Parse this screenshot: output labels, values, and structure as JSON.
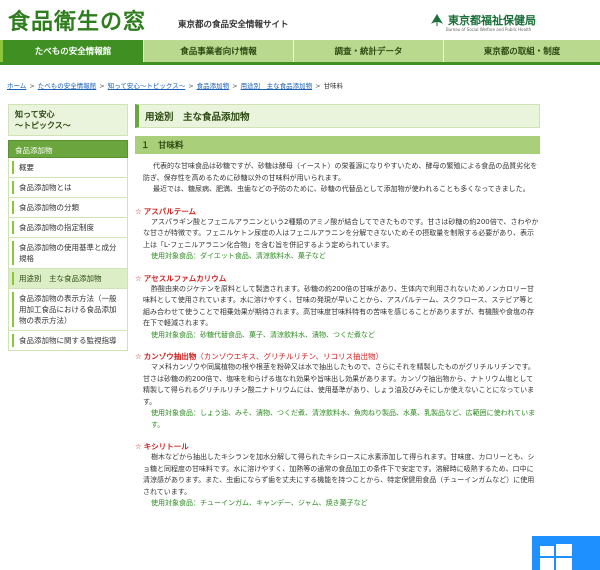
{
  "header": {
    "site_title": "食品衛生の窓",
    "site_subtitle": "東京都の食品安全情報サイト",
    "org_name": "東京都福祉保健局",
    "org_name_en": "Bureau of Social Welfare and Public Health"
  },
  "nav": {
    "items": [
      {
        "label": "たべもの安全情報館"
      },
      {
        "label": "食品事業者向け情報"
      },
      {
        "label": "調査・統計データ"
      },
      {
        "label": "東京都の取組・制度"
      }
    ]
  },
  "breadcrumb": {
    "items": [
      {
        "label": "ホーム"
      },
      {
        "label": "たべもの安全情報館"
      },
      {
        "label": "知って安心～トピックス～"
      },
      {
        "label": "食品添加物"
      },
      {
        "label": "用途別　主な食品添加物"
      }
    ],
    "current": "甘味料",
    "separator": ">"
  },
  "sidebar": {
    "heading_line1": "知って安心",
    "heading_line2": "～トピックス～",
    "category": "食品添加物",
    "items": [
      {
        "label": "概要"
      },
      {
        "label": "食品添加物とは"
      },
      {
        "label": "食品添加物の分類"
      },
      {
        "label": "食品添加物の指定制度"
      },
      {
        "label": "食品添加物の使用基準と成分規格"
      },
      {
        "label": "用途別　主な食品添加物"
      },
      {
        "label": "食品添加物の表示方法（一般用加工食品における食品添加物の表示方法）"
      },
      {
        "label": "食品添加物に関する監視指導"
      }
    ]
  },
  "main": {
    "page_title": "用途別　主な食品添加物",
    "section_title": "１　甘味料",
    "intro_1": "代表的な甘味食品は砂糖ですが、砂糖は酵母（イースト）の栄養源になりやすいため、酵母の繁殖による食品の品質劣化を防ぎ、保存性を高めるために砂糖以外の甘味料が用いられます。",
    "intro_2": "最近では、糖尿病、肥満、虫歯などの予防のために、砂糖の代替品として添加物が使われることも多くなってきました。",
    "items": [
      {
        "title": "アスパルテーム",
        "alias": "",
        "body": "アスパラギン酸とフェニルアラニンという2種類のアミノ酸が結合してできたものです。甘さは砂糖の約200倍で、さわやかな甘さが特徴です。フェニルケトン尿症の人はフェニルアラニンを分解できないためその摂取量を制限する必要があり、表示上は「L-フェニルアラニン化合物」を含む旨を併記するよう定められています。",
        "food": "使用対象食品：ダイエット食品、清涼飲料水、菓子など"
      },
      {
        "title": "アセスルファムカリウム",
        "alias": "",
        "body": "酢酸由来のジケテンを原料として製造されます。砂糖の約200倍の甘味があり、生体内で利用されないためノンカロリー甘味料として使用されています。水に溶けやすく、甘味の発現が早いことから、アスパルテーム、スクラロース、ステビア等と組み合わせて使うことで相乗効果が期待されます。高甘味度甘味料特有の苦味を感じることがありますが、有機酸や食塩の存在下で軽減されます。",
        "food": "使用対象食品：砂糖代替食品、菓子、清涼飲料水、漬物、つくだ煮など"
      },
      {
        "title": "カンゾウ抽出物",
        "alias": "（カンゾウエキス、グリチルリチン、リコリス抽出物）",
        "body": "マメ科カンゾウや同属植物の根や根茎を粉砕又は水で抽出したもので、さらにそれを精製したものがグリチルリチンです。甘さは砂糖の約200倍で、塩味を和らげる塩なれ効果や旨味出し効果があります。カンゾウ抽出物から、ナトリウム塩として精製して得られるグリチルリチン酸二ナトリウムには、使用基準があり、しょう油及びみそにしか使えないことになっています。",
        "food": "使用対象食品：しょう油、みそ、漬物、つくだ煮、清涼飲料水、魚肉ねり製品、水菓、乳製品など、広範囲に使われています。"
      },
      {
        "title": "キシリトール",
        "alias": "",
        "body": "樹木などから抽出したキシランを加水分解して得られたキシロースに水素添加して得られます。甘味度、カロリーとも、ショ糖と同程度の甘味料です。水に溶けやすく、加熱等の通常の食品加工の条件下で安定です。溶解時に吸熱するため、口中に清涼感があります。また、虫歯にならず歯を丈夫にする機能を持つことから、特定保健用食品（チューインガムなど）に使用されています。",
        "food": "使用対象食品：チューインガム、キャンデー、ジャム、焼き菓子など"
      }
    ]
  },
  "colors": {
    "brand_green": "#2f7d1e",
    "nav_bg": "#b9d98f",
    "nav_active": "#3f8f22",
    "item_title_red": "#cc2222",
    "food_green": "#2c8a20",
    "link_blue": "#1a5fb4"
  }
}
